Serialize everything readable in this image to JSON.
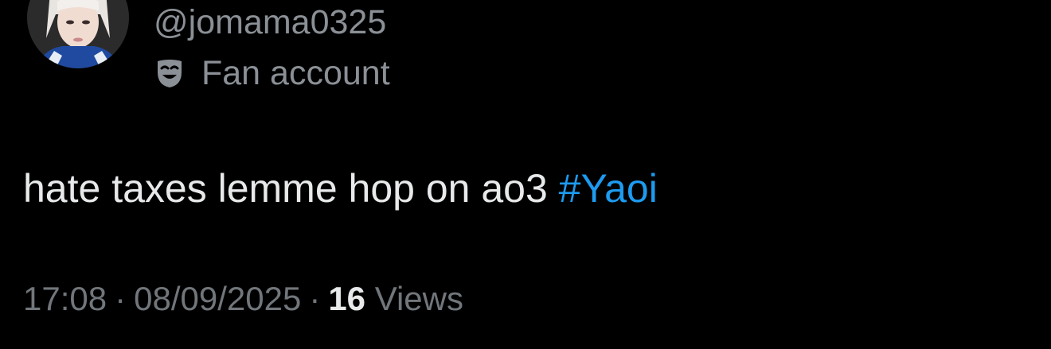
{
  "user": {
    "handle": "@jomama0325",
    "label": "Fan account",
    "label_icon": "theater-mask-icon",
    "avatar_icon": "profile-avatar"
  },
  "tweet": {
    "text": "hate taxes lemme hop on ao3",
    "hashtag": "#Yaoi"
  },
  "meta": {
    "time": "17:08",
    "separator": "·",
    "date": "08/09/2025",
    "views_count": "16",
    "views_label": "Views"
  },
  "colors": {
    "background": "#000000",
    "primary_text": "#e7e9ea",
    "secondary_text": "#71767b",
    "hashtag": "#1d9bf0"
  }
}
